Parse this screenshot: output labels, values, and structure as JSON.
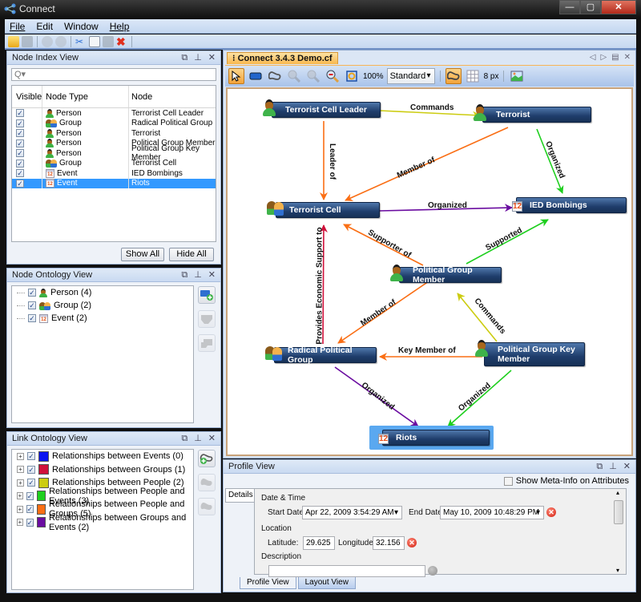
{
  "window": {
    "title": "Connect",
    "controls": {
      "minimize": "—",
      "maximize": "▢",
      "close": "✕"
    }
  },
  "menu": {
    "items": [
      {
        "label": "File",
        "mnemonic": "F"
      },
      {
        "label": "Edit",
        "mnemonic": ""
      },
      {
        "label": "Window",
        "mnemonic": ""
      },
      {
        "label": "Help",
        "mnemonic": "H"
      }
    ]
  },
  "toolbar": {
    "icons": [
      "open-folder-icon",
      "save-icon",
      "undo-icon",
      "redo-icon",
      "cut-icon",
      "copy-icon",
      "paste-icon",
      "delete-icon"
    ]
  },
  "node_index": {
    "title": "Node Index View",
    "search_placeholder": "Q▾",
    "columns": [
      "Visible",
      "Node Type",
      "Node"
    ],
    "rows": [
      {
        "visible": true,
        "type": "Person",
        "icon": "person",
        "node": "Terrorist Cell Leader",
        "selected": false
      },
      {
        "visible": true,
        "type": "Group",
        "icon": "group",
        "node": "Radical Political Group",
        "selected": false
      },
      {
        "visible": true,
        "type": "Person",
        "icon": "person",
        "node": "Terrorist",
        "selected": false
      },
      {
        "visible": true,
        "type": "Person",
        "icon": "person",
        "node": "Political Group Member",
        "selected": false
      },
      {
        "visible": true,
        "type": "Person",
        "icon": "person",
        "node": "Political Group Key Member",
        "selected": false
      },
      {
        "visible": true,
        "type": "Group",
        "icon": "group",
        "node": "Terrorist Cell",
        "selected": false
      },
      {
        "visible": true,
        "type": "Event",
        "icon": "event",
        "node": "IED Bombings",
        "selected": false
      },
      {
        "visible": true,
        "type": "Event",
        "icon": "event",
        "node": "Riots",
        "selected": true
      }
    ],
    "show_all": "Show All",
    "hide_all": "Hide All"
  },
  "node_ontology": {
    "title": "Node Ontology View",
    "items": [
      {
        "label": "Person (4)",
        "icon": "person",
        "checked": true
      },
      {
        "label": "Group (2)",
        "icon": "group",
        "checked": true
      },
      {
        "label": "Event (2)",
        "icon": "event",
        "checked": true
      }
    ]
  },
  "link_ontology": {
    "title": "Link Ontology View",
    "items": [
      {
        "label": "Relationships between Events (0)",
        "color": "#0a14f0",
        "checked": true
      },
      {
        "label": "Relationships between Groups (1)",
        "color": "#d0103a",
        "checked": true
      },
      {
        "label": "Relationships between People (2)",
        "color": "#cccc10",
        "checked": true
      },
      {
        "label": "Relationships between People and Events (3)",
        "color": "#1ecf1e",
        "checked": true
      },
      {
        "label": "Relationships between People and Groups (5)",
        "color": "#fa6e14",
        "checked": true
      },
      {
        "label": "Relationships between Groups and Events (2)",
        "color": "#6a0ca0",
        "checked": true
      }
    ]
  },
  "document": {
    "tab_label": "Connect 3.4.3 Demo.cf",
    "zoom": "100%",
    "layout_mode": "Standard",
    "grid_size": "8 px"
  },
  "graph": {
    "nodes": [
      {
        "id": "tcl",
        "label": "Terrorist Cell Leader",
        "kind": "person"
      },
      {
        "id": "ter",
        "label": "Terrorist",
        "kind": "person"
      },
      {
        "id": "tc",
        "label": "Terrorist Cell",
        "kind": "group"
      },
      {
        "id": "ied",
        "label": "IED Bombings",
        "kind": "event"
      },
      {
        "id": "pgm",
        "label": "Political Group Member",
        "kind": "person"
      },
      {
        "id": "rpg",
        "label": "Radical Political Group",
        "kind": "group"
      },
      {
        "id": "pgkm",
        "label": "Political Group Key Member",
        "kind": "person"
      },
      {
        "id": "riots",
        "label": "Riots",
        "kind": "event",
        "selected": true
      }
    ],
    "edges": [
      {
        "from": "tcl",
        "to": "ter",
        "label": "Commands",
        "color": "#cccc10"
      },
      {
        "from": "tcl",
        "to": "tc",
        "label": "Leader of",
        "color": "#fa6e14"
      },
      {
        "from": "ter",
        "to": "tc",
        "label": "Member of",
        "color": "#fa6e14"
      },
      {
        "from": "ter",
        "to": "ied",
        "label": "Organized",
        "color": "#1ecf1e"
      },
      {
        "from": "tc",
        "to": "ied",
        "label": "Organized",
        "color": "#6a0ca0"
      },
      {
        "from": "pgm",
        "to": "tc",
        "label": "Supporter of",
        "color": "#fa6e14"
      },
      {
        "from": "pgm",
        "to": "ied",
        "label": "Supported",
        "color": "#1ecf1e"
      },
      {
        "from": "rpg",
        "to": "tc",
        "label": "Provides Economic Support to",
        "color": "#d0103a"
      },
      {
        "from": "pgm",
        "to": "rpg",
        "label": "Member of",
        "color": "#fa6e14"
      },
      {
        "from": "pgkm",
        "to": "pgm",
        "label": "Commands",
        "color": "#cccc10"
      },
      {
        "from": "pgkm",
        "to": "rpg",
        "label": "Key Member of",
        "color": "#fa6e14"
      },
      {
        "from": "rpg",
        "to": "riots",
        "label": "Organized",
        "color": "#6a0ca0"
      },
      {
        "from": "pgkm",
        "to": "riots",
        "label": "Organized",
        "color": "#1ecf1e"
      }
    ]
  },
  "profile": {
    "title": "Profile View",
    "meta_info_label": "Show Meta-Info on Attributes",
    "meta_info_checked": false,
    "details_tab": "Details",
    "section_datetime": "Date & Time",
    "start_date_label": "Start Date",
    "start_date": "Apr 22, 2009 3:54:29 AM",
    "end_date_label": "End Date",
    "end_date": "May 10, 2009 10:48:29 PM",
    "section_location": "Location",
    "latitude_label": "Latitude:",
    "latitude": "29.625",
    "longitude_label": "Longitude:",
    "longitude": "32.156",
    "section_description": "Description",
    "description": ""
  },
  "bottom_tabs": [
    "Profile View",
    "Layout View"
  ],
  "panel_controls": {
    "restore": "⧉",
    "pin": "⊥",
    "close": "✕"
  }
}
